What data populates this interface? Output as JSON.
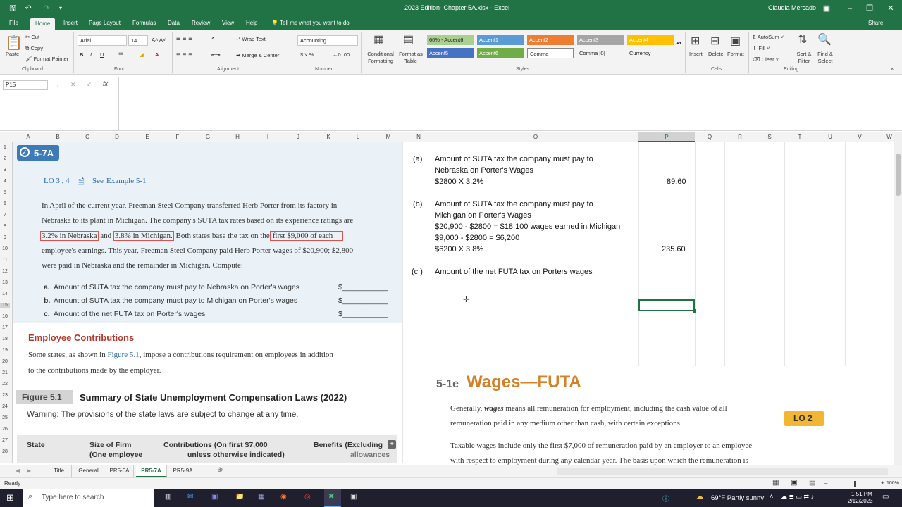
{
  "titlebar": {
    "file_title": "2023 Edition- Chapter 5A.xlsx  -  Excel",
    "user": "Claudia Mercado"
  },
  "tabs": [
    "File",
    "Home",
    "Insert",
    "Page Layout",
    "Formulas",
    "Data",
    "Review",
    "View",
    "Help"
  ],
  "tell_me": "Tell me what you want to do",
  "share": "Share",
  "ribbon": {
    "clipboard": {
      "cut": "Cut",
      "copy": "Copy",
      "paste": "Paste",
      "format_painter": "Format Painter",
      "group": "Clipboard"
    },
    "font": {
      "name": "Arial",
      "size": "14",
      "group": "Font"
    },
    "alignment": {
      "wrap": "Wrap Text",
      "merge": "Merge & Center",
      "group": "Alignment"
    },
    "number": {
      "format": "Accounting",
      "group": "Number"
    },
    "styles": {
      "cond": "Conditional Formatting",
      "fmt_table": "Format as Table",
      "group": "Styles",
      "cells": [
        {
          "label": "60% - Accent6",
          "bg": "#a9d08e",
          "fg": "#222"
        },
        {
          "label": "Accent1",
          "bg": "#5b9bd5",
          "fg": "#fff"
        },
        {
          "label": "Accent2",
          "bg": "#ed7d31",
          "fg": "#fff"
        },
        {
          "label": "Accent3",
          "bg": "#a5a5a5",
          "fg": "#fff"
        },
        {
          "label": "Accent4",
          "bg": "#ffc000",
          "fg": "#fff"
        },
        {
          "label": "Accent5",
          "bg": "#4472c4",
          "fg": "#fff"
        },
        {
          "label": "Accent6",
          "bg": "#70ad47",
          "fg": "#fff"
        },
        {
          "label": "Comma",
          "bg": "#ffffff",
          "fg": "#222"
        },
        {
          "label": "Comma [0]",
          "bg": "#f3f3f3",
          "fg": "#222"
        },
        {
          "label": "Currency",
          "bg": "#f3f3f3",
          "fg": "#222"
        }
      ]
    },
    "cells": {
      "insert": "Insert",
      "delete": "Delete",
      "format": "Format",
      "group": "Cells"
    },
    "editing": {
      "autosum": "AutoSum",
      "fill": "Fill",
      "clear": "Clear",
      "sort": "Sort & Filter",
      "find": "Find & Select",
      "group": "Editing"
    }
  },
  "namebox": "P15",
  "columns": [
    "A",
    "B",
    "C",
    "D",
    "E",
    "F",
    "G",
    "H",
    "I",
    "J",
    "K",
    "L",
    "M",
    "N",
    "O",
    "P",
    "Q",
    "R",
    "S",
    "T",
    "U",
    "V",
    "W"
  ],
  "rows": [
    "1",
    "2",
    "3",
    "4",
    "5",
    "6",
    "7",
    "8",
    "9",
    "10",
    "11",
    "12",
    "13",
    "14",
    "15",
    "16",
    "17",
    "18",
    "19",
    "20",
    "21",
    "22",
    "23",
    "24",
    "25",
    "26",
    "27",
    "28"
  ],
  "problem": {
    "badge": "5-7A",
    "lo": "LO 3 , 4",
    "see": "See",
    "example": "Example 5-1",
    "p1": "In April of the current year, Freeman Steel Company transferred Herb Porter from its factory in",
    "p2": "Nebraska to its plant in Michigan. The company's SUTA tax rates based on its experience ratings are",
    "p3a": "3.2% in Nebraska",
    "p3b": "and",
    "p3c": "3.8% in Michigan.",
    "p3d": "Both states base the tax on the",
    "p3e": "first $9,000 of each",
    "p4": "employee's earnings. This year, Freeman Steel Company paid Herb Porter wages of $20,900; $2,800",
    "p5": "were paid in Nebraska and the remainder in Michigan. Compute:",
    "items": [
      {
        "letter": "a.",
        "text": "Amount of SUTA tax the company must pay to Nebraska on Porter's wages",
        "blank": "$___________"
      },
      {
        "letter": "b.",
        "text": "Amount of SUTA tax the company must pay to Michigan on Porter's wages",
        "blank": "$___________"
      },
      {
        "letter": "c.",
        "text": "Amount of the net FUTA tax on Porter's wages",
        "blank": "$___________"
      }
    ]
  },
  "contrib": {
    "heading": "Employee Contributions",
    "t1": "Some states, as shown in",
    "fig_link": "Figure 5.1",
    "t2": ", impose a contributions requirement on employees in addition",
    "t3": "to the contributions made by the employer.",
    "fig_num": "Figure 5.1",
    "fig_title": "Summary of State Unemployment Compensation Laws (2022)",
    "warning": "Warning: The provisions of the state laws are subject to change at any time.",
    "th_state": "State",
    "th_size1": "Size of Firm",
    "th_size2": "(One employee",
    "th_contrib1": "Contributions (On first $7,000",
    "th_contrib2": "unless otherwise indicated)",
    "th_benefits1": "Benefits (Excluding",
    "th_benefits2": "allowances"
  },
  "answers": {
    "a_label": "(a)",
    "a_l1": "Amount of SUTA tax the company must pay to",
    "a_l2": "Nebraska on Porter's Wages",
    "a_l3": "$2800 X 3.2%",
    "a_val": "89.60",
    "b_label": "(b)",
    "b_l1": "Amount of SUTA tax the company must pay to",
    "b_l2": "Michigan on Porter's Wages",
    "b_l3": "$20,900 - $2800 = $18,100 wages earned in Michigan",
    "b_l4": "$9,000 - $2800 = $6,200",
    "b_l5": "$6200 X 3.8%",
    "b_val": "235.60",
    "c_label": "(c )",
    "c_l1": "Amount of the net FUTA tax on Porters wages"
  },
  "wages": {
    "sec": "5-1e",
    "title": "Wages—FUTA",
    "p1a": "Generally,",
    "p1b": "wages",
    "p1c": "means all remuneration for employment, including the cash value of all",
    "p2": "remuneration paid in any medium other than cash, with certain exceptions.",
    "lo": "LO 2",
    "p3": "Taxable wages include only the first $7,000 of remuneration paid by an employer to an employee",
    "p4": "with respect to employment during any calendar year. The basis upon which the remuneration is"
  },
  "sheets": [
    "Title",
    "General",
    "PR5-6A",
    "PR5-7A",
    "PR5-9A"
  ],
  "active_sheet": "PR5-7A",
  "status": {
    "ready": "Ready",
    "zoom": "100%"
  },
  "taskbar": {
    "search": "Type here to search",
    "weather": "69°F  Partly sunny",
    "time": "1:51 PM",
    "date": "2/12/2023"
  }
}
